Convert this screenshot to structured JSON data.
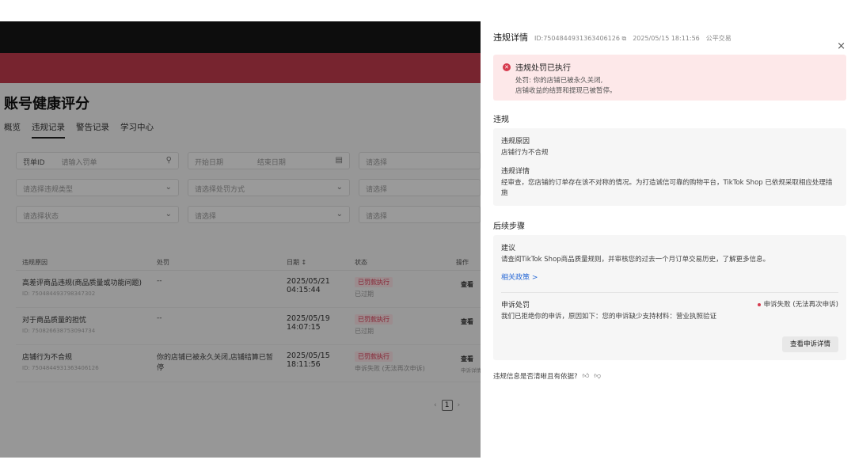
{
  "page": {
    "title": "账号健康评分",
    "tabs": [
      "概览",
      "违规记录",
      "警告记录",
      "学习中心"
    ],
    "active_tab": 1,
    "filters": {
      "order_id_label": "罚单ID",
      "order_id_placeholder": "请输入罚单",
      "date_start": "开始日期",
      "date_end": "结束日期",
      "f3": "请选择违规类型",
      "f4": "请选择",
      "f5": "请选择处罚方式",
      "f6": "请选择",
      "f7": "请选择状态",
      "f8": "请选择",
      "f9": "请选择"
    },
    "table": {
      "headers": [
        "违规原因",
        "处罚",
        "日期",
        "状态",
        "操作"
      ],
      "rows": [
        {
          "reason": "高差评商品违规(商品质量或功能问题)",
          "id": "ID: 750484493798347302",
          "penalty": "--",
          "date": "2025/05/21",
          "time": "04:15:44",
          "status_tag": "已罚款执行",
          "status_sub": "已过期",
          "action": "查看",
          "action_sub": ""
        },
        {
          "reason": "对于商品质量的担忧",
          "id": "ID: 750826638753094734",
          "penalty": "--",
          "date": "2025/05/19",
          "time": "14:07:15",
          "status_tag": "已罚款执行",
          "status_sub": "已过期",
          "action": "查看",
          "action_sub": ""
        },
        {
          "reason": "店铺行为不合规",
          "id": "ID: 7504844931363406126",
          "penalty": "你的店铺已被永久关闭,店铺结算已暂停",
          "date": "2025/05/15",
          "time": "18:11:56",
          "status_tag": "已罚款执行",
          "status_sub": "申诉失败 (无法再次申诉)",
          "action": "查看",
          "action_sub": "申诉详情"
        }
      ]
    },
    "pagination": {
      "current": "1"
    }
  },
  "drawer": {
    "title": "违规详情",
    "id_text": "ID:7504844931363406126",
    "copy_icon": "copy-icon",
    "date": "2025/05/15 18:11:56",
    "category": "公平交易",
    "close_glyph": "×",
    "alert": {
      "title": "违规处罚已执行",
      "line1": "处罚: 你的店铺已被永久关闭,",
      "line2": "店铺收益的结算和提现已被暂停。"
    },
    "violation": {
      "section_title": "违规",
      "reason_label": "违规原因",
      "reason_value": "店铺行为不合规",
      "detail_label": "违规详情",
      "detail_value": "经审查，您店铺的订单存在该不对称的情况。为打造诚信可靠的购物平台，TikTok Shop 已依规采取相应处理措施"
    },
    "next_steps": {
      "section_title": "后续步骤",
      "suggest_label": "建议",
      "suggest_value": "请查阅TikTok Shop商品质量规则，并审核您的过去一个月订单交易历史，了解更多信息。",
      "policy_link": "相关政策 >",
      "appeal_label": "申诉处罚",
      "appeal_status": "申诉失败 (无法再次申诉)",
      "appeal_value": "我们已拒绝你的申诉，原因如下：您的申诉缺少支持材料：营业执照验证",
      "appeal_button": "查看申诉详情"
    },
    "feedback": {
      "question": "违规信息是否清晰且有依据?",
      "icons": [
        "thumbs-up-icon",
        "thumbs-down-icon"
      ]
    }
  }
}
